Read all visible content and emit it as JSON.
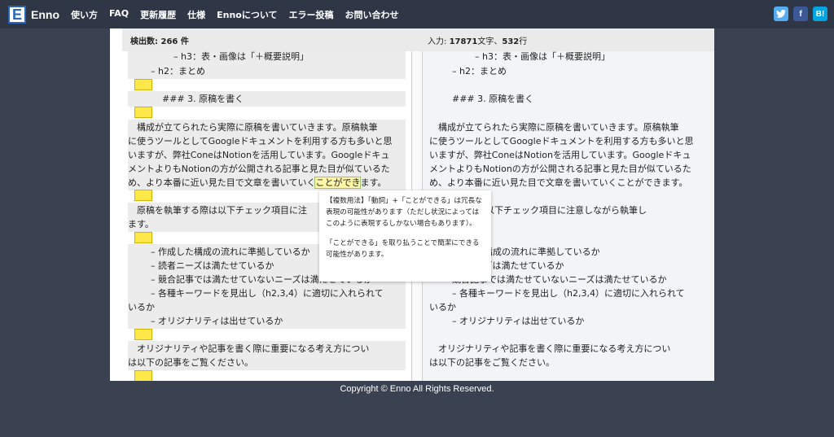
{
  "header": {
    "logo_letter": "E",
    "logo_text": "Enno",
    "nav": [
      "使い方",
      "FAQ",
      "更新履歴",
      "仕様",
      "Ennoについて",
      "エラー投稿",
      "お問い合わせ"
    ],
    "social": [
      "twitter",
      "f",
      "B!"
    ]
  },
  "status": {
    "count_label": "検出数: 266 件",
    "input_prefix": "入力: ",
    "chars": "17871",
    "chars_unit": "文字、",
    "lines": "532",
    "lines_unit": "行"
  },
  "left_pane": {
    "l1": "– h3：表・画像は「＋概要説明」",
    "l2": "– h2：まとめ",
    "l3": "### 3. 原稿を書く",
    "l4": "　構成が立てられたら実際に原稿を書いていきます。原稿執筆",
    "l5": "に使うツールとしてGoogleドキュメントを利用する方も多いと思",
    "l6": "いますが、弊社ConeはNotionを活用しています。Googleドキュ",
    "l7": "メントよりもNotionの方が公開される記事と見た目が似ているた",
    "l8_pre": "め、より本番に近い見た目で文章を書いていく",
    "l8_hl": "ことができ",
    "l8_post": "ます。",
    "l9": "　原稿を執筆する際は以下チェック項目に注",
    "l10": "ます。",
    "l11": "– 作成した構成の流れに準拠しているか",
    "l12": "– 読者ニーズは満たせているか",
    "l13": "– 競合記事では満たせていないニーズは満たせているか",
    "l14": "– 各種キーワードを見出し（h2,3,4）に適切に入れられて",
    "l15": "いるか",
    "l16": "– オリジナリティは出せているか",
    "l17": "　オリジナリティや記事を書く際に重要になる考え方につい",
    "l18": "は以下の記事をご覧ください。"
  },
  "right_pane": {
    "l1": "– h3：表・画像は「＋概要説明」",
    "l2": "– h2：まとめ",
    "l3": "### 3. 原稿を書く",
    "l4": "　構成が立てられたら実際に原稿を書いていきます。原稿執筆",
    "l5": "に使うツールとしてGoogleドキュメントを利用する方も多いと思",
    "l6": "いますが、弊社ConeはNotionを活用しています。Googleドキュ",
    "l7": "メントよりもNotionの方が公開される記事と見た目が似ているた",
    "l8": "め、より本番に近い見た目で文章を書いていくことができます。",
    "l9": "筆する際は以下チェック項目に注意しながら執筆し",
    "l11": "た構成の流れに準拠しているか",
    "l12": "ーズは満たせているか",
    "l13": "競合記事では満たせていないニーズは満たせているか",
    "l14": "– 各種キーワードを見出し（h2,3,4）に適切に入れられて",
    "l15": "いるか",
    "l16": "– オリジナリティは出せているか",
    "l17": "　オリジナリティや記事を書く際に重要になる考え方につい",
    "l18": "は以下の記事をご覧ください。"
  },
  "tooltip": {
    "p1": "【複数用法】「動詞」+「ことができる」は冗長な表現の可能性があります（ただし状況によってはこのように表現するしかない場合もあります）。",
    "p2": "「ことができる」を取り払うことで簡潔にできる可能性があります。"
  },
  "footer": "Copyright © Enno All Rights Reserved."
}
